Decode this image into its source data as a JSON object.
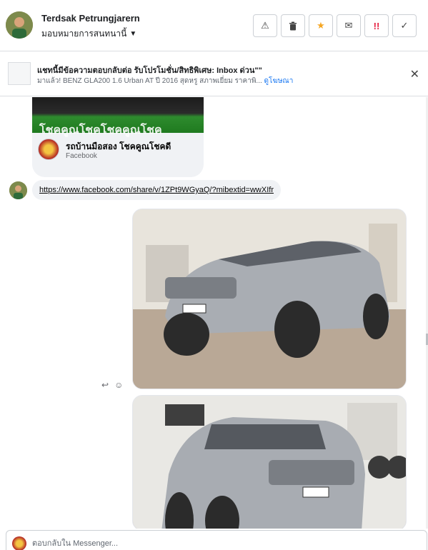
{
  "header": {
    "contact_name": "Terdsak Petrungjarern",
    "assign_label": "มอบหมายการสนทนานี้",
    "actions": [
      {
        "icon": "warning-icon",
        "glyph": "⚠"
      },
      {
        "icon": "trash-icon",
        "glyph": "🗑"
      },
      {
        "icon": "star-icon",
        "glyph": "★"
      },
      {
        "icon": "mail-icon",
        "glyph": "✉"
      },
      {
        "icon": "urgent-icon",
        "glyph": "!!"
      },
      {
        "icon": "check-icon",
        "glyph": "✓"
      }
    ]
  },
  "ad": {
    "title": "แชทนี้มีข้อความตอบกลับต่อ รับโปรโมชั่น/สิทธิพิเศษ: Inbox ด่วน\"\"",
    "subtitle": "มาแล้ว! BENZ GLA200 1.6 Urban AT ปี 2016 สุดหรู สภาพเยี่ยม ราคาพิ...",
    "link": "ดูโฆษณา",
    "close_glyph": "✕"
  },
  "chat": {
    "card": {
      "image_text": "โชคคูณโชคโชคคูณโชค",
      "title": "รถบ้านมือสอง โชคคูณโชคดี",
      "source": "Facebook"
    },
    "link_message": "https://www.facebook.com/share/v/1ZPt9WGyaQ/?mibextid=wwXIfr",
    "photo1_alt": "Silver SUV photo 1",
    "photo2_alt": "Silver SUV photo 2",
    "tools": {
      "reply_glyph": "↩",
      "react_glyph": "☺"
    }
  },
  "composer": {
    "placeholder": "ตอบกลับใน Messenger..."
  }
}
